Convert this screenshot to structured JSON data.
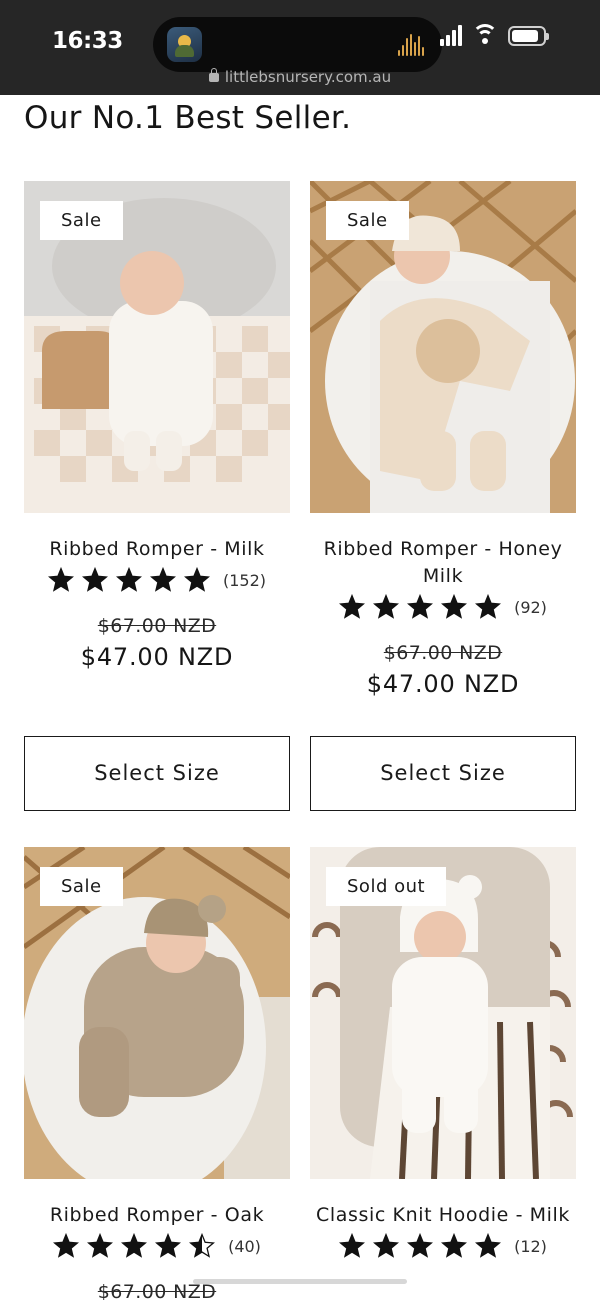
{
  "status_bar": {
    "time": "16:33",
    "url": "littlebsnursery.com.au",
    "icons": [
      "signal-icon",
      "wifi-icon",
      "battery-icon"
    ]
  },
  "section": {
    "title": "Our No.1 Best Seller."
  },
  "colors": {
    "text": "#1a1a1a",
    "status_bar_bg": "#262626",
    "star": "#111111"
  },
  "products": [
    {
      "badge": "Sale",
      "title": "Ribbed Romper - Milk",
      "rating": 5,
      "reviews": "(152)",
      "compare_price": "$67.00 NZD",
      "price": "$47.00 NZD",
      "button": "Select Size"
    },
    {
      "badge": "Sale",
      "title": "Ribbed Romper - Honey Milk",
      "rating": 5,
      "reviews": "(92)",
      "compare_price": "$67.00 NZD",
      "price": "$47.00 NZD",
      "button": "Select Size"
    },
    {
      "badge": "Sale",
      "title": "Ribbed Romper - Oak",
      "rating": 4.5,
      "reviews": "(40)",
      "compare_price": "$67.00 NZD",
      "price": "",
      "button": ""
    },
    {
      "badge": "Sold out",
      "title": "Classic Knit Hoodie - Milk",
      "rating": 5,
      "reviews": "(12)",
      "compare_price": "",
      "price": "",
      "button": ""
    }
  ]
}
